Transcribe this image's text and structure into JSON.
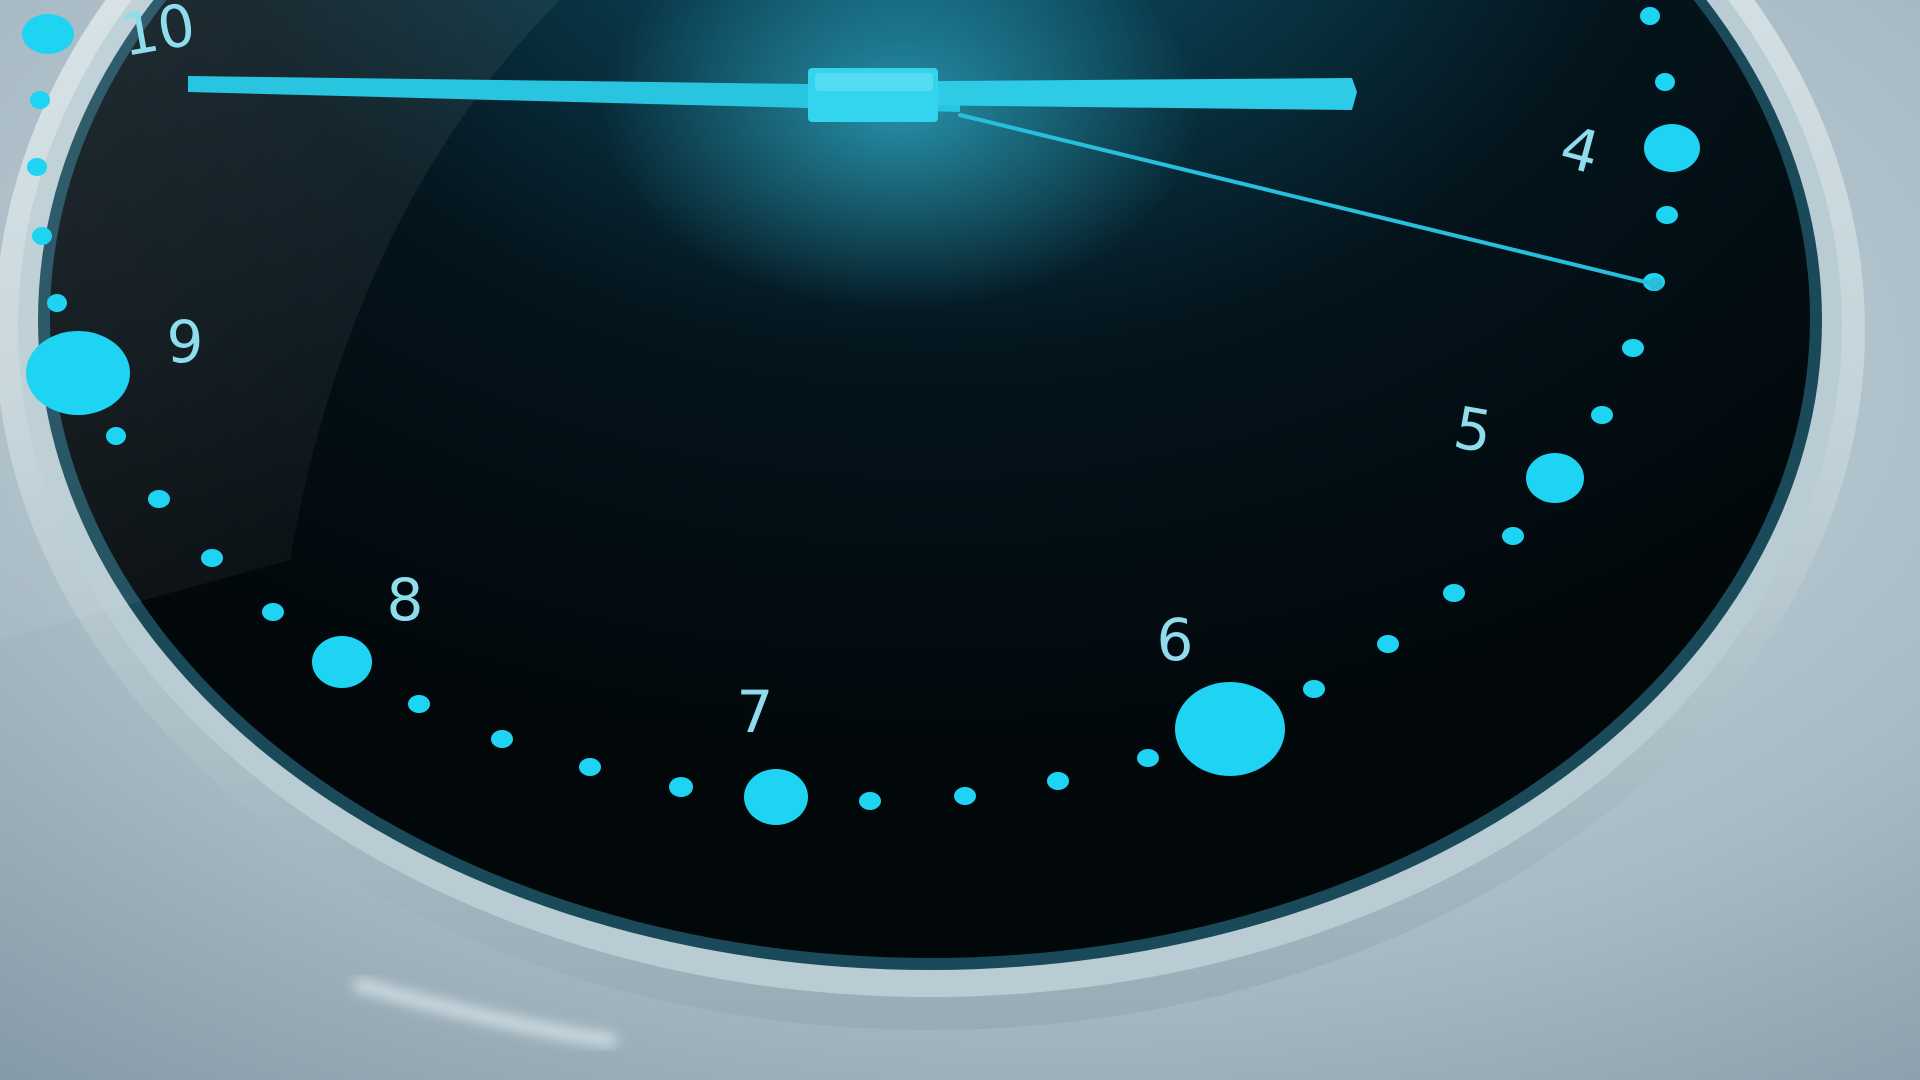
{
  "clock": {
    "numerals": [
      {
        "label": "10"
      },
      {
        "label": "9"
      },
      {
        "label": "8"
      },
      {
        "label": "7"
      },
      {
        "label": "6"
      },
      {
        "label": "5"
      },
      {
        "label": "4"
      }
    ],
    "colors": {
      "dial_face": "#030b10",
      "marker": "#1fd4f2",
      "numeral": "#8fdcec",
      "hand": "#28bfdc",
      "bezel": "#cfdde2",
      "glow": "#0f6e8c",
      "wall": "#9fb2bd"
    }
  }
}
